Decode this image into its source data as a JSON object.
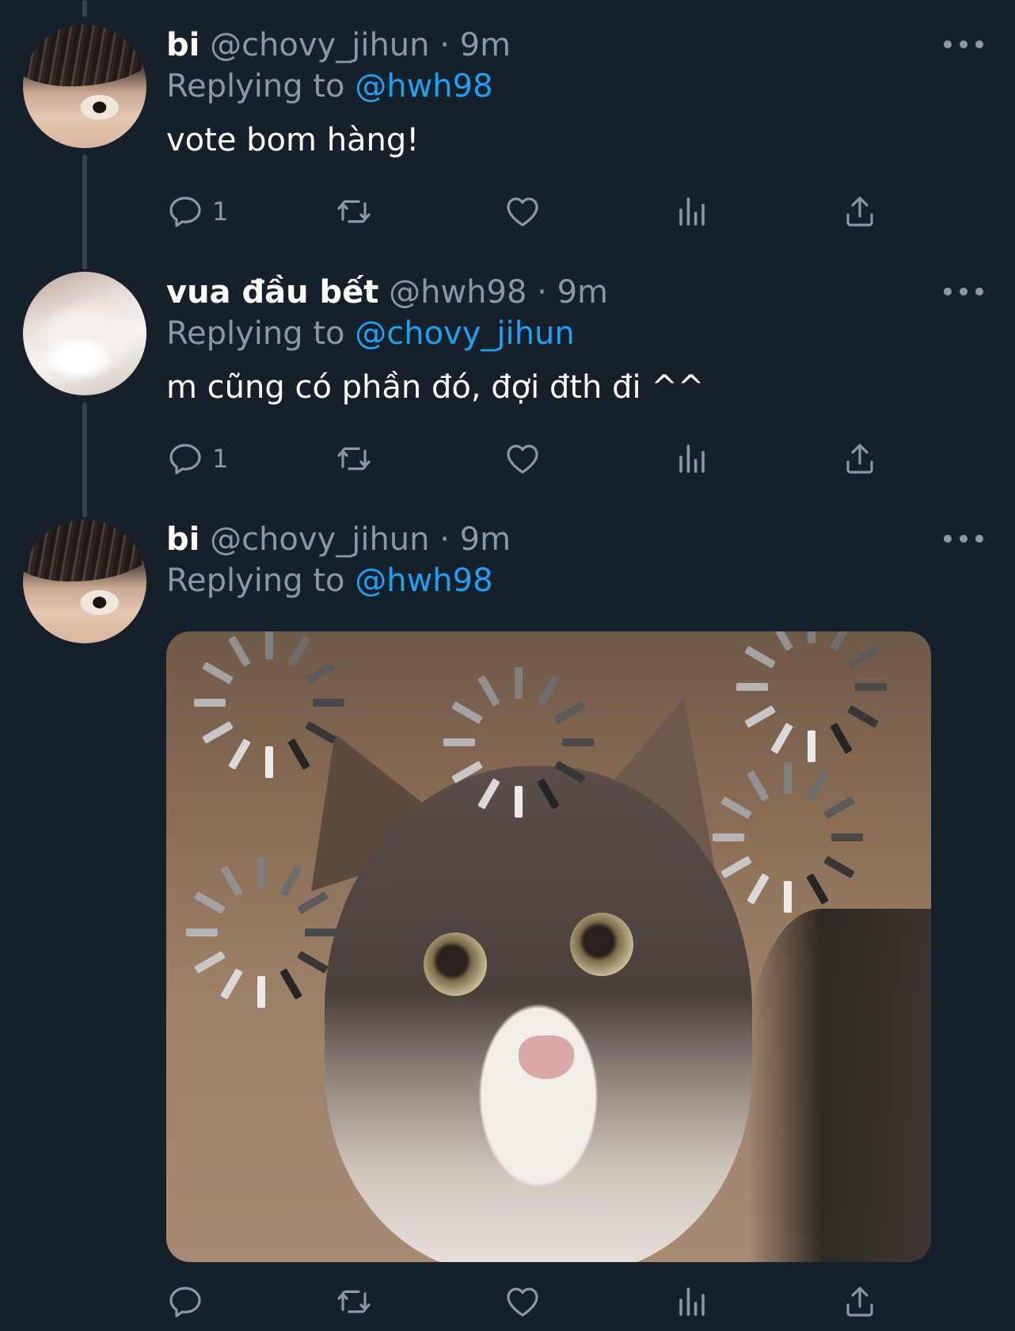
{
  "colors": {
    "background": "#15202b",
    "muted": "#8899a6",
    "link": "#1da1f2",
    "thread_line": "#38444d"
  },
  "tweets": [
    {
      "name": "bi",
      "handle": "@chovy_jihun",
      "separator": "·",
      "time": "9m",
      "replying_label": "Replying to",
      "replying_to": "@hwh98",
      "text": "vote bom hàng!",
      "reply_count": "1",
      "avatar": "person-avatar"
    },
    {
      "name": "vua đầu bết",
      "handle": "@hwh98",
      "separator": "·",
      "time": "9m",
      "replying_label": "Replying to",
      "replying_to": "@chovy_jihun",
      "text": "m cũng có phần đó, đợi đth đi ^^",
      "reply_count": "1",
      "avatar": "cat-avatar"
    },
    {
      "name": "bi",
      "handle": "@chovy_jihun",
      "separator": "·",
      "time": "9m",
      "replying_label": "Replying to",
      "replying_to": "@hwh98",
      "media": "cat-loading-meme-image",
      "avatar": "person-avatar"
    }
  ],
  "icons": {
    "reply": "reply-icon",
    "retweet": "retweet-icon",
    "like": "like-icon",
    "analytics": "analytics-icon",
    "share": "share-icon",
    "more": "more-icon"
  }
}
